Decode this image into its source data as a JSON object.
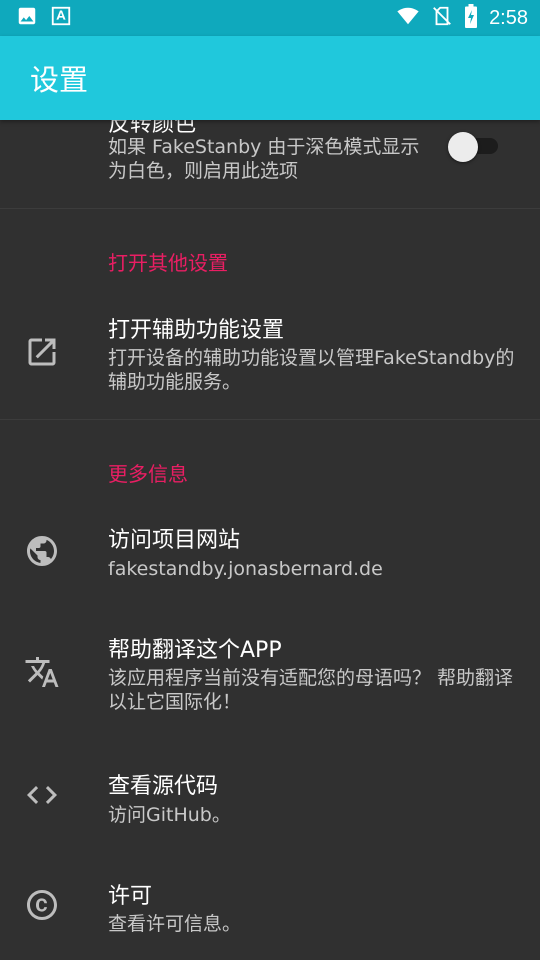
{
  "status_bar": {
    "time": "2:58",
    "left_icons": [
      "image-icon",
      "text-format-icon"
    ],
    "right_icons": [
      "wifi-icon",
      "no-sim-icon",
      "battery-charging-icon"
    ]
  },
  "app_bar": {
    "title": "设置"
  },
  "settings": {
    "invert_color": {
      "title_partial": "反转颜色",
      "summary": "如果 FakeStanby 由于深色模式显示为白色，则启用此选项",
      "enabled": false
    },
    "category_other": "打开其他设置",
    "accessibility": {
      "title": "打开辅助功能设置",
      "summary": "打开设备的辅助功能设置以管理FakeStandby的辅助功能服务。",
      "icon": "open-in-new-icon"
    },
    "category_more": "更多信息",
    "website": {
      "title": "访问项目网站",
      "summary": "fakestandby.jonasbernard.de",
      "icon": "globe-icon"
    },
    "translate": {
      "title": "帮助翻译这个APP",
      "summary": "该应用程序当前没有适配您的母语吗？ 帮助翻译以让它国际化！",
      "icon": "translate-icon"
    },
    "source": {
      "title": "查看源代码",
      "summary": "访问GitHub。",
      "icon": "code-icon"
    },
    "license": {
      "title": "许可",
      "summary": "查看许可信息。",
      "icon": "copyright-icon"
    }
  },
  "colors": {
    "status_bar": "#0fa9bd",
    "app_bar": "#20c8dc",
    "background": "#303030",
    "category_accent": "#e91e63"
  }
}
